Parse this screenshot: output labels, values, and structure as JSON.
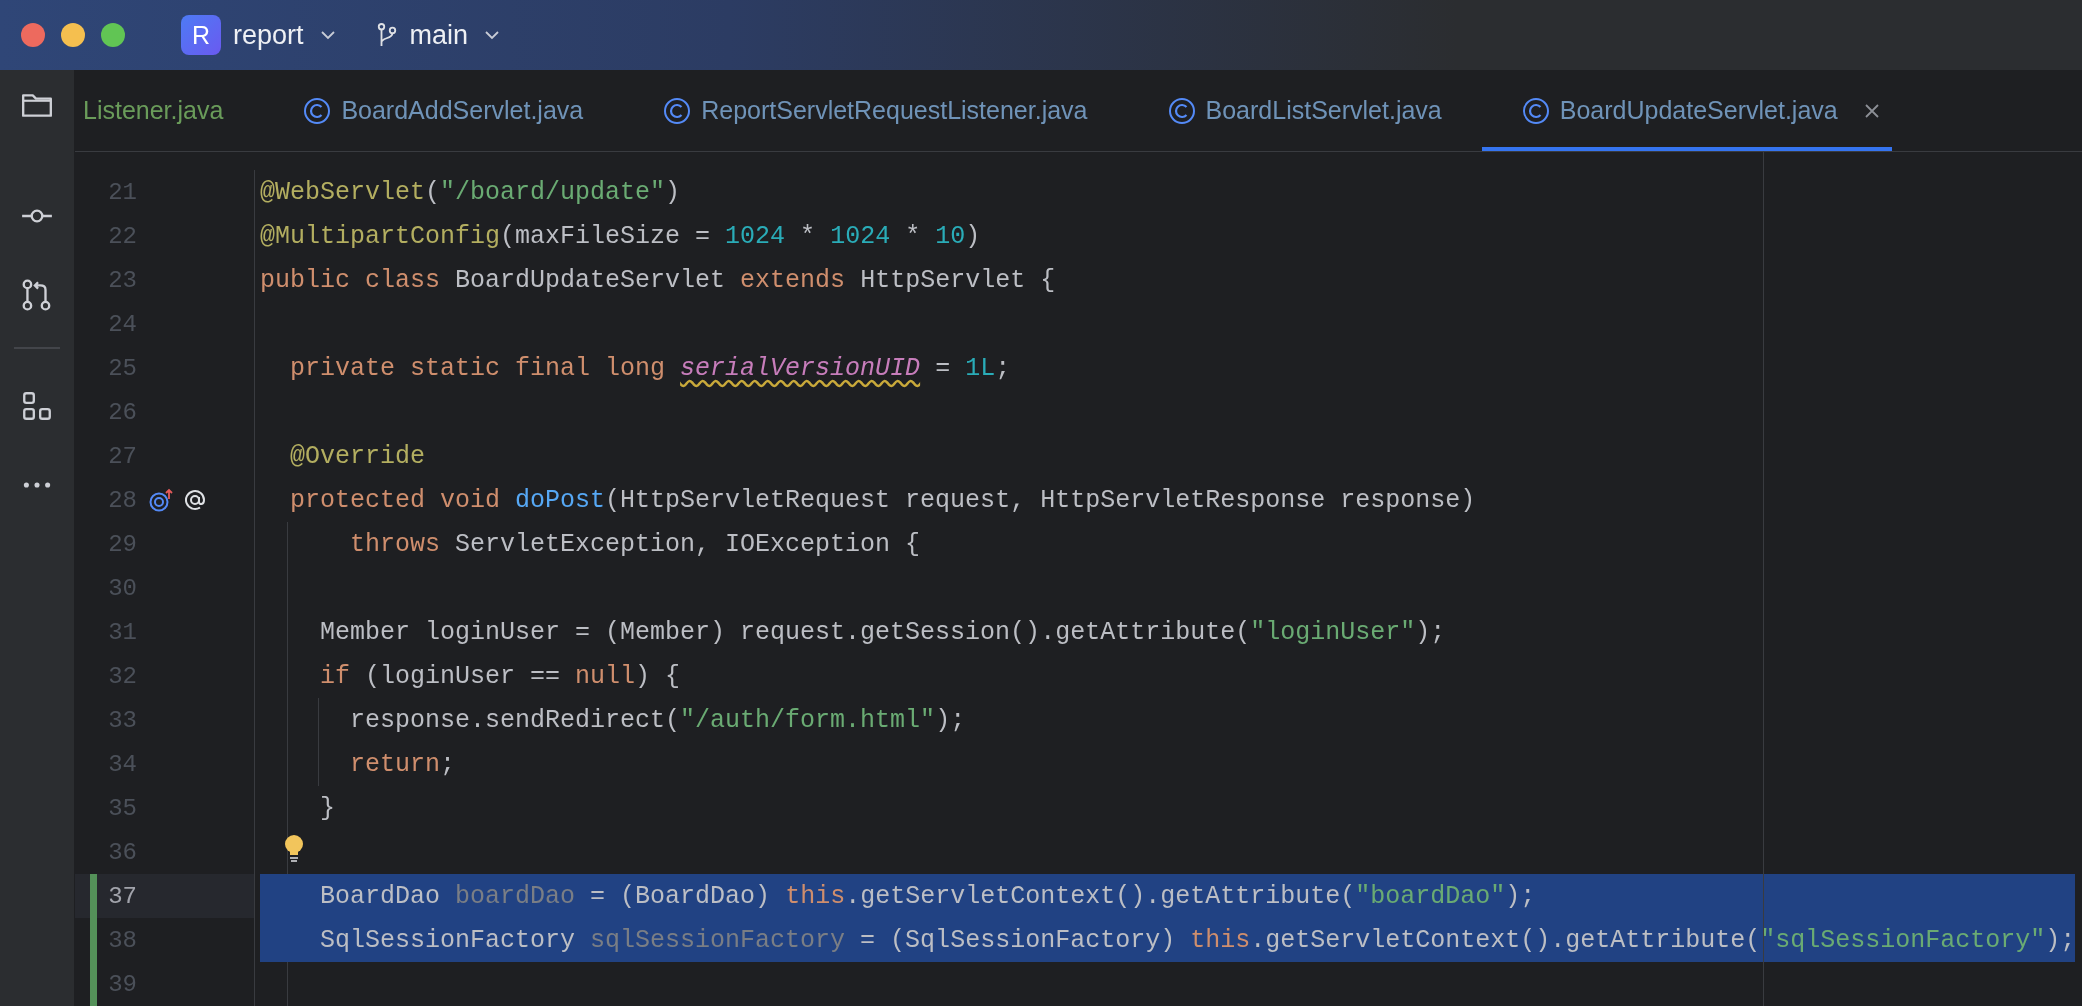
{
  "title_bar": {
    "project": {
      "initial": "R",
      "name": "report"
    },
    "branch": "main"
  },
  "tool_strip": [
    {
      "kind": "folder"
    },
    {
      "kind": "commit"
    },
    {
      "kind": "pull-requests"
    },
    {
      "kind": "divider"
    },
    {
      "kind": "structure"
    },
    {
      "kind": "more"
    }
  ],
  "tabs": [
    {
      "label": "Listener.java",
      "kind": "file",
      "color": "#6a9c5a",
      "selected": false
    },
    {
      "label": "BoardAddServlet.java",
      "kind": "class",
      "color": "#6f93b8",
      "selected": false
    },
    {
      "label": "ReportServletRequestListener.java",
      "kind": "class",
      "color": "#6f93b8",
      "selected": false
    },
    {
      "label": "BoardListServlet.java",
      "kind": "class",
      "color": "#6f93b8",
      "selected": false
    },
    {
      "label": "BoardUpdateServlet.java",
      "kind": "class",
      "color": "#6f93b8",
      "selected": true
    }
  ],
  "lines": [
    {
      "number": "21",
      "selected": false,
      "current": false,
      "changed": false,
      "bulb": false,
      "tokens": [
        {
          "kind": "ann",
          "text": "@WebServlet"
        },
        {
          "kind": "plain",
          "text": "("
        },
        {
          "kind": "str",
          "text": "\"/board/update\""
        },
        {
          "kind": "plain",
          "text": ")"
        }
      ]
    },
    {
      "number": "22",
      "selected": false,
      "current": false,
      "changed": false,
      "bulb": false,
      "tokens": [
        {
          "kind": "ann",
          "text": "@MultipartConfig"
        },
        {
          "kind": "plain",
          "text": "(maxFileSize = "
        },
        {
          "kind": "num",
          "text": "1024"
        },
        {
          "kind": "plain",
          "text": " * "
        },
        {
          "kind": "num",
          "text": "1024"
        },
        {
          "kind": "plain",
          "text": " * "
        },
        {
          "kind": "num",
          "text": "10"
        },
        {
          "kind": "plain",
          "text": ")"
        }
      ]
    },
    {
      "number": "23",
      "selected": false,
      "current": false,
      "changed": false,
      "bulb": false,
      "tokens": [
        {
          "kind": "kw",
          "text": "public class"
        },
        {
          "kind": "plain",
          "text": " BoardUpdateServlet "
        },
        {
          "kind": "kw",
          "text": "extends"
        },
        {
          "kind": "plain",
          "text": " HttpServlet {"
        }
      ]
    },
    {
      "number": "24",
      "selected": false,
      "current": false,
      "changed": false,
      "bulb": false
    },
    {
      "number": "25",
      "selected": false,
      "current": false,
      "changed": false,
      "bulb": false,
      "tokens": [
        {
          "kind": "kw",
          "text": "  private static final long "
        },
        {
          "kind": "field",
          "text": "serialVersionUID",
          "warning": true
        },
        {
          "kind": "plain",
          "text": " = "
        },
        {
          "kind": "num",
          "text": "1L"
        },
        {
          "kind": "plain",
          "text": ";"
        }
      ]
    },
    {
      "number": "26",
      "selected": false,
      "current": false,
      "changed": false,
      "bulb": false
    },
    {
      "number": "27",
      "selected": false,
      "current": false,
      "changed": false,
      "bulb": false,
      "tokens": [
        {
          "kind": "ann",
          "text": "  @Override"
        }
      ]
    },
    {
      "number": "28",
      "selected": false,
      "current": false,
      "changed": false,
      "bulb": false,
      "gutter_icons": [
        {
          "kind": "overrides"
        },
        {
          "kind": "annotation"
        }
      ],
      "tokens": [
        {
          "kind": "kw",
          "text": "  protected void "
        },
        {
          "kind": "decl",
          "text": "doPost"
        },
        {
          "kind": "plain",
          "text": "(HttpServletRequest request, HttpServletResponse response)"
        }
      ]
    },
    {
      "number": "29",
      "selected": false,
      "current": false,
      "changed": false,
      "bulb": false,
      "tokens": [
        {
          "kind": "kw",
          "text": "      throws"
        },
        {
          "kind": "plain",
          "text": " ServletException, IOException {"
        }
      ]
    },
    {
      "number": "30",
      "selected": false,
      "current": false,
      "changed": false,
      "bulb": false
    },
    {
      "number": "31",
      "selected": false,
      "current": false,
      "changed": false,
      "bulb": false,
      "tokens": [
        {
          "kind": "plain",
          "text": "    Member loginUser = (Member) request.getSession().getAttribute("
        },
        {
          "kind": "str",
          "text": "\"loginUser\""
        },
        {
          "kind": "plain",
          "text": ");"
        }
      ]
    },
    {
      "number": "32",
      "selected": false,
      "current": false,
      "changed": false,
      "bulb": false,
      "tokens": [
        {
          "kind": "kw",
          "text": "    if"
        },
        {
          "kind": "plain",
          "text": " (loginUser == "
        },
        {
          "kind": "kw",
          "text": "null"
        },
        {
          "kind": "plain",
          "text": ") {"
        }
      ]
    },
    {
      "number": "33",
      "selected": false,
      "current": false,
      "changed": false,
      "bulb": false,
      "tokens": [
        {
          "kind": "plain",
          "text": "      response.sendRedirect("
        },
        {
          "kind": "str",
          "text": "\"/auth/form.html\""
        },
        {
          "kind": "plain",
          "text": ");"
        }
      ]
    },
    {
      "number": "34",
      "selected": false,
      "current": false,
      "changed": false,
      "bulb": false,
      "tokens": [
        {
          "kind": "kw",
          "text": "      return"
        },
        {
          "kind": "plain",
          "text": ";"
        }
      ]
    },
    {
      "number": "35",
      "selected": false,
      "current": false,
      "changed": false,
      "bulb": false,
      "tokens": [
        {
          "kind": "plain",
          "text": "    }"
        }
      ]
    },
    {
      "number": "36",
      "selected": false,
      "current": false,
      "changed": false,
      "bulb": true
    },
    {
      "number": "37",
      "selected": true,
      "current": true,
      "changed": true,
      "bulb": false,
      "tokens": [
        {
          "kind": "plain",
          "text": "    BoardDao "
        },
        {
          "kind": "unused",
          "text": "boardDao"
        },
        {
          "kind": "plain",
          "text": " = (BoardDao) "
        },
        {
          "kind": "kw",
          "text": "this"
        },
        {
          "kind": "plain",
          "text": ".getServletContext().getAttribute("
        },
        {
          "kind": "str",
          "text": "\"boardDao\""
        },
        {
          "kind": "plain",
          "text": ");"
        }
      ]
    },
    {
      "number": "38",
      "selected": true,
      "current": false,
      "changed": true,
      "bulb": false,
      "tokens": [
        {
          "kind": "plain",
          "text": "    SqlSessionFactory "
        },
        {
          "kind": "unused",
          "text": "sqlSessionFactory"
        },
        {
          "kind": "plain",
          "text": " = (SqlSessionFactory) "
        },
        {
          "kind": "kw",
          "text": "this"
        },
        {
          "kind": "plain",
          "text": ".getServletContext().getAttribute("
        },
        {
          "kind": "str",
          "text": "\"sqlSessionFactory\""
        },
        {
          "kind": "plain",
          "text": ");"
        }
      ]
    },
    {
      "number": "39",
      "selected": false,
      "current": false,
      "changed": true,
      "bulb": false
    }
  ]
}
